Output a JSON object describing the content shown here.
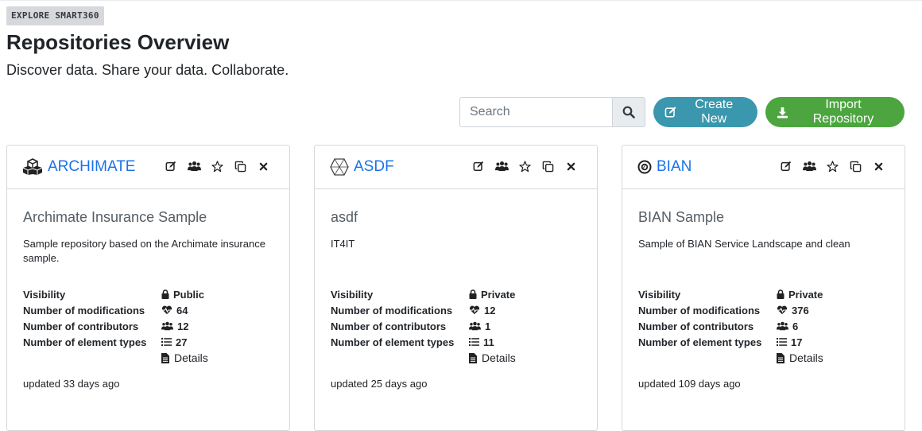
{
  "header": {
    "badge": "EXPLORE SMART360",
    "title": "Repositories Overview",
    "subtitle": "Discover data. Share your data. Collaborate."
  },
  "toolbar": {
    "search_placeholder": "Search",
    "create_label": "Create New",
    "import_label": "Import Repository"
  },
  "colors": {
    "link": "#1a73e8",
    "create_button": "#3a97ad",
    "import_button": "#4ca53f"
  },
  "stat_labels": {
    "visibility": "Visibility",
    "modifications": "Number of modifications",
    "contributors": "Number of contributors",
    "element_types": "Number of element types",
    "details": "Details"
  },
  "cards": [
    {
      "icon": "cubes-icon",
      "title": "ARCHIMATE",
      "repo_name": "Archimate Insurance Sample",
      "description": "Sample repository based on the Archimate insurance sample.",
      "visibility": "Public",
      "modifications": "64",
      "contributors": "12",
      "element_types": "27",
      "updated": "updated 33 days ago"
    },
    {
      "icon": "hexagon-icon",
      "title": "ASDF",
      "repo_name": "asdf",
      "description": "IT4IT",
      "visibility": "Private",
      "modifications": "12",
      "contributors": "1",
      "element_types": "11",
      "updated": "updated 25 days ago"
    },
    {
      "icon": "target-circle-icon",
      "title": "BIAN",
      "repo_name": "BIAN Sample",
      "description": "Sample of BIAN Service Landscape and clean",
      "visibility": "Private",
      "modifications": "376",
      "contributors": "6",
      "element_types": "17",
      "updated": "updated 109 days ago"
    }
  ]
}
